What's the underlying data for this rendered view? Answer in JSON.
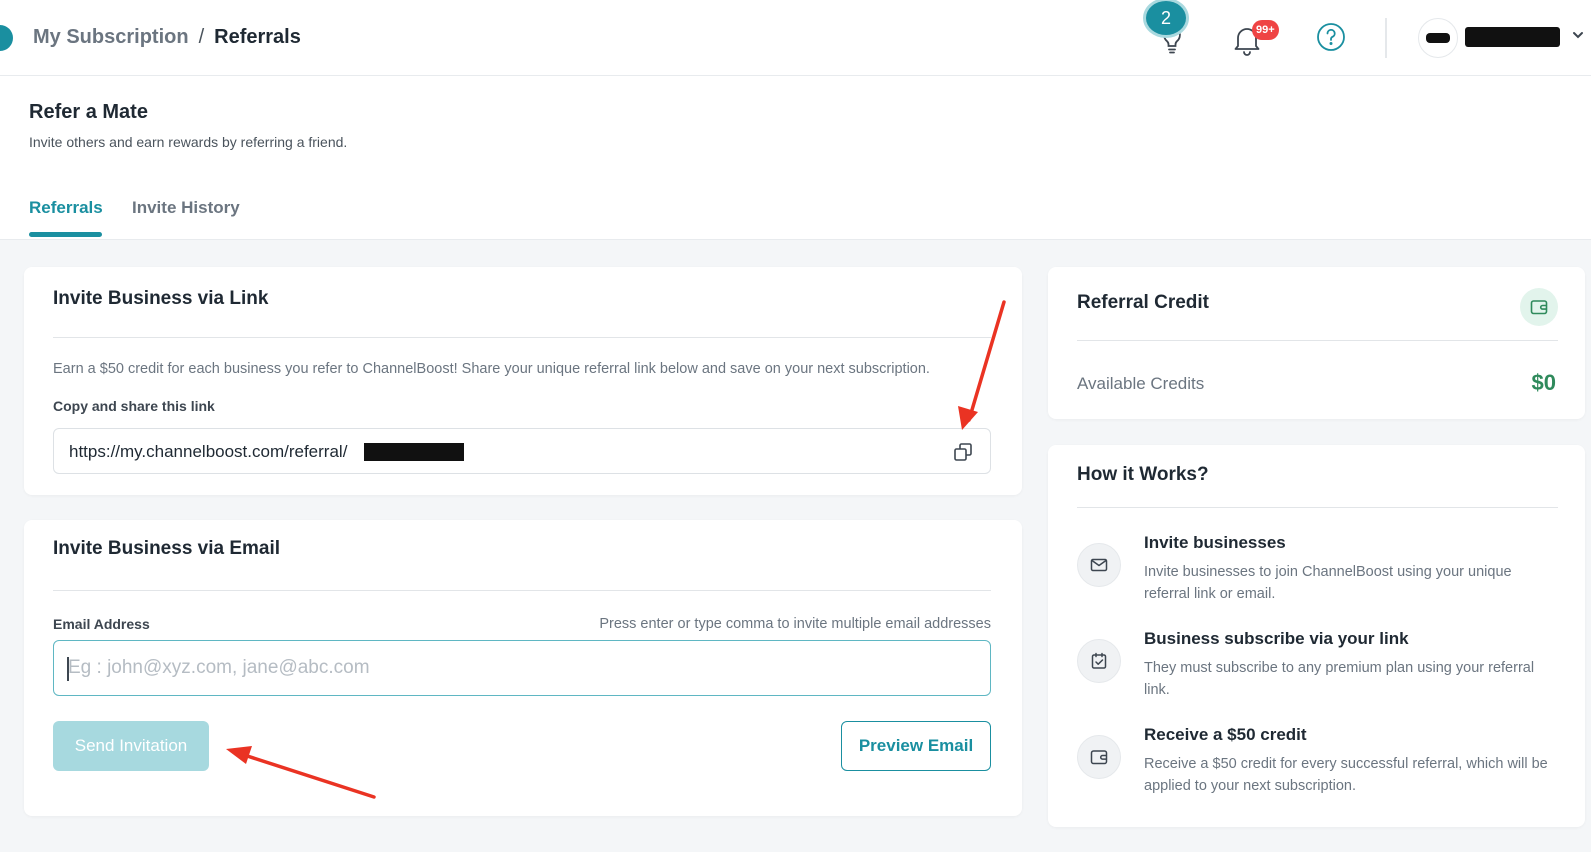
{
  "topbar": {
    "breadcrumb_parent": "My Subscription",
    "breadcrumb_sep": "/",
    "breadcrumb_current": "Referrals",
    "tips_badge": "2",
    "notifications_badge": "99+",
    "icons": [
      "lightbulb-icon",
      "bell-icon",
      "help-icon",
      "chevron-down-icon"
    ]
  },
  "header": {
    "title": "Refer a Mate",
    "subtitle": "Invite others and earn rewards by referring a friend.",
    "tabs": [
      {
        "label": "Referrals",
        "active": true
      },
      {
        "label": "Invite History",
        "active": false
      }
    ]
  },
  "link_card": {
    "title": "Invite Business via Link",
    "description": "Earn a $50 credit for each business you refer to ChannelBoost! Share your unique referral link below and save on your next subscription.",
    "copy_label": "Copy and share this link",
    "link_value": "https://my.channelboost.com/referral/"
  },
  "email_card": {
    "title": "Invite Business via Email",
    "email_label": "Email Address",
    "hint": "Press enter or type comma to invite multiple email addresses",
    "placeholder": "Eg : john@xyz.com, jane@abc.com",
    "send_label": "Send Invitation",
    "preview_label": "Preview Email"
  },
  "credit_card": {
    "title": "Referral Credit",
    "available_label": "Available Credits",
    "available_value": "$0"
  },
  "how_it_works": {
    "title": "How it Works?",
    "steps": [
      {
        "icon": "mail-icon",
        "title": "Invite businesses",
        "desc": "Invite businesses to join ChannelBoost using your unique referral link or email."
      },
      {
        "icon": "calendar-check-icon",
        "title": "Business subscribe via your link",
        "desc": "They must subscribe to any premium plan using your referral link."
      },
      {
        "icon": "wallet-icon",
        "title": "Receive a $50 credit",
        "desc": "Receive a $50 credit for every successful referral, which will be applied to your next subscription."
      }
    ]
  },
  "colors": {
    "accent": "#1a8fa0",
    "success": "#2f8a5c",
    "badge": "#ef4444",
    "annotation": "#ea3323"
  }
}
